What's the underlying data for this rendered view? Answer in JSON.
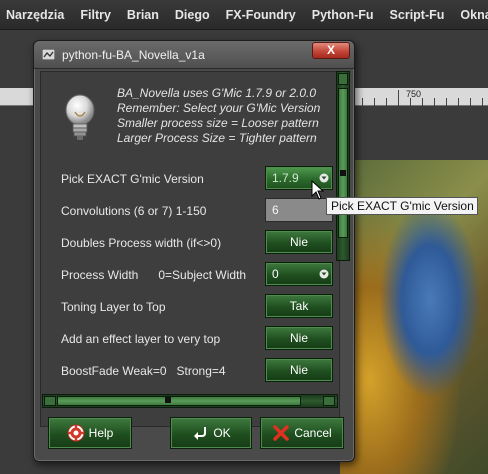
{
  "menubar": {
    "items": [
      "Narzędzia",
      "Filtry",
      "Brian",
      "Diego",
      "FX-Foundry",
      "Python-Fu",
      "Script-Fu",
      "Okna"
    ]
  },
  "ruler": {
    "label": "750"
  },
  "dialog": {
    "title": "python-fu-BA_Novella_v1a",
    "close_label": "X",
    "description_lines": [
      "BA_Novella uses G'Mic 1.7.9 or 2.0.0",
      "Remember: Select your G'Mic Version",
      "Smaller process size = Looser pattern",
      "Larger Process Size = Tighter pattern"
    ],
    "fields": [
      {
        "label": "Pick EXACT G'mic Version",
        "value": "1.7.9"
      },
      {
        "label": "Convolutions (6 or 7) 1-150",
        "value": "6"
      },
      {
        "label": "Doubles Process width (if<>0)",
        "value": "Nie"
      },
      {
        "label": "Process Width      0=Subject Width",
        "value": "0"
      },
      {
        "label": "Toning Layer to Top",
        "value": "Tak"
      },
      {
        "label": "Add an effect layer to very top",
        "value": "Nie"
      },
      {
        "label": "BoostFade Weak=0   Strong=4",
        "value": "Nie"
      }
    ],
    "buttons": {
      "help": "Help",
      "ok": "OK",
      "cancel": "Cancel"
    }
  },
  "tooltip": {
    "text": "Pick EXACT G'mic Version"
  },
  "colors": {
    "accent_green": "#1f4e1f",
    "close_red": "#c4473a",
    "dialog_bg": "#4a4a4a"
  },
  "icons": [
    "bulb-icon",
    "dialog-icon",
    "help-icon",
    "ok-icon",
    "cancel-icon",
    "dropdown-arrow-icon"
  ]
}
